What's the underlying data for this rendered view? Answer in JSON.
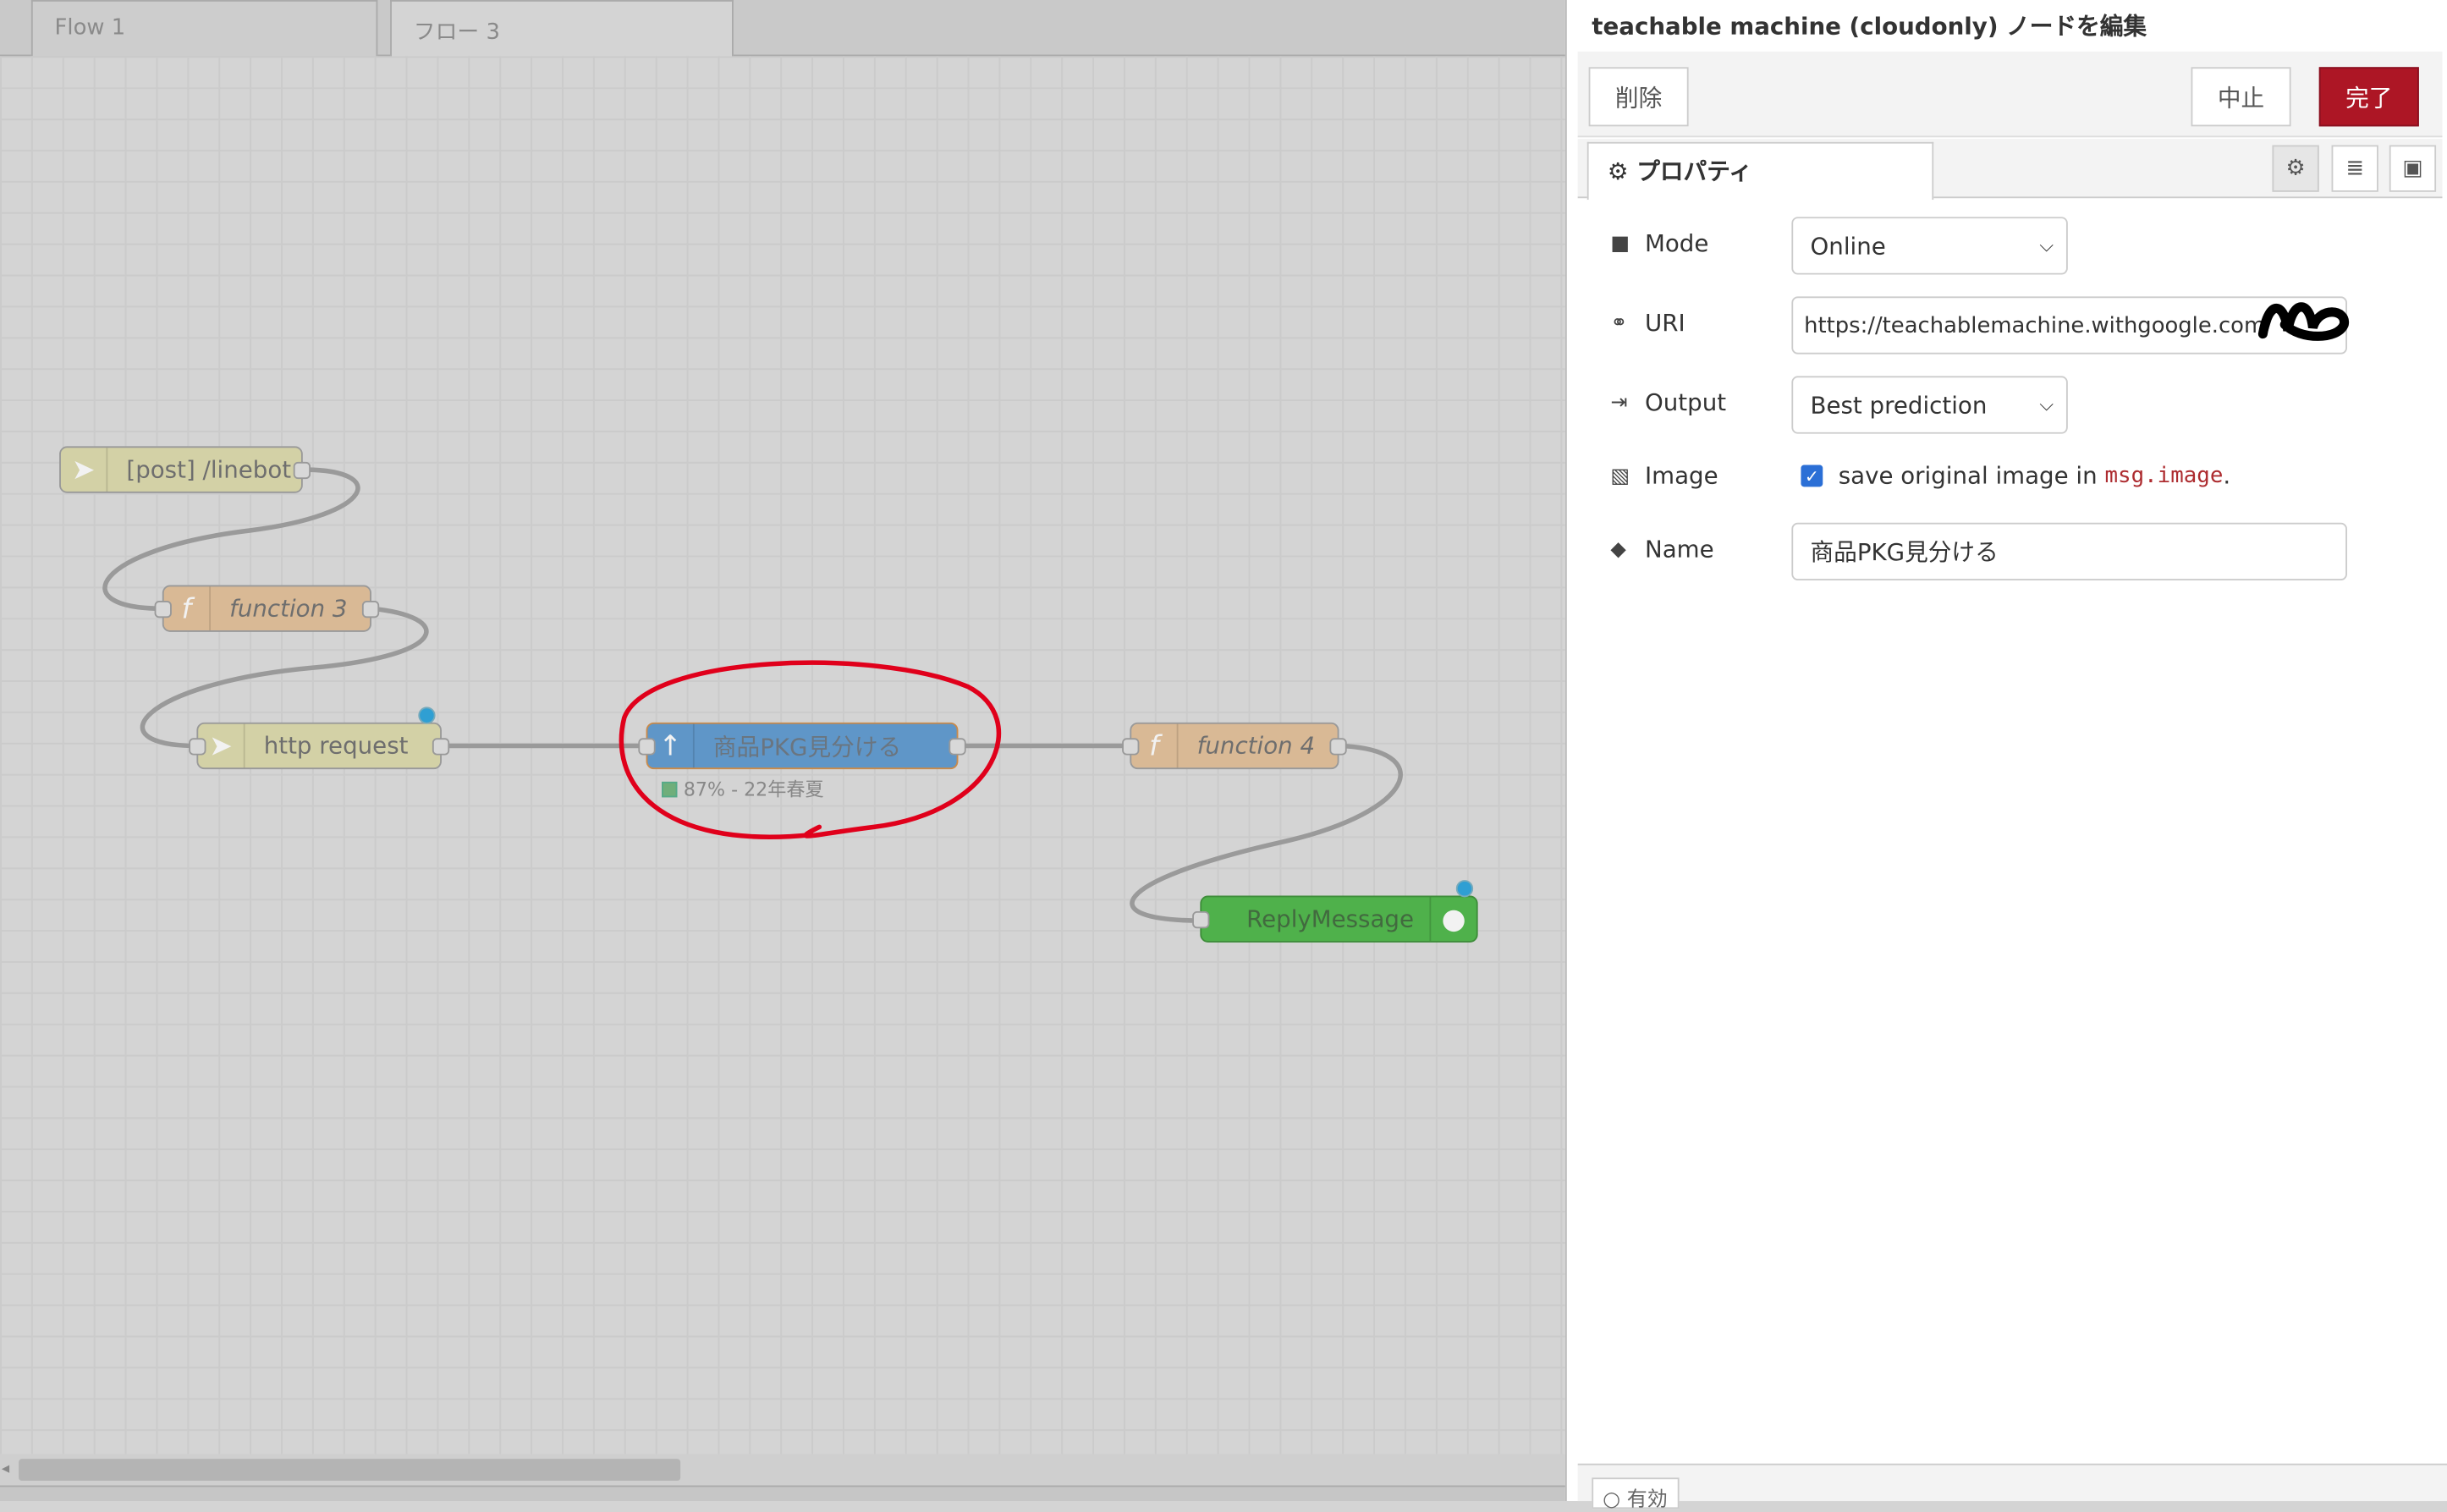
{
  "tabs": [
    {
      "label": "Flow 1"
    },
    {
      "label": "フロー 3"
    }
  ],
  "nodes": {
    "http_in": {
      "label": "[post] /linebot"
    },
    "function3": {
      "label": "function 3"
    },
    "http_request": {
      "label": "http request"
    },
    "teachable": {
      "label": "商品PKG見分ける",
      "status": "87% - 22年春夏"
    },
    "function4": {
      "label": "function 4"
    },
    "reply": {
      "label": "ReplyMessage"
    }
  },
  "panel": {
    "title": "teachable machine (cloudonly) ノードを編集",
    "delete_label": "削除",
    "cancel_label": "中止",
    "done_label": "完了",
    "tab_label": "プロパティ",
    "mode": {
      "label": "Mode",
      "value": "Online"
    },
    "uri": {
      "label": "URI",
      "value": "https://teachablemachine.withgoogle.com/"
    },
    "output": {
      "label": "Output",
      "value": "Best prediction"
    },
    "image": {
      "label": "Image",
      "checkbox_text": "save original image in",
      "code": "msg.image",
      "suffix": ".",
      "checked": true
    },
    "name": {
      "label": "Name",
      "value": "商品PKG見分ける"
    },
    "footer_label": "有効"
  },
  "colors": {
    "accent": "#ad1625",
    "annotation": "#e0001b",
    "tm_node": "#5f96c8",
    "reply_node": "#4fb14b"
  },
  "icons": [
    "gear-icon",
    "file-icon",
    "link-icon",
    "sign-out-icon",
    "image-icon",
    "tag-icon"
  ]
}
